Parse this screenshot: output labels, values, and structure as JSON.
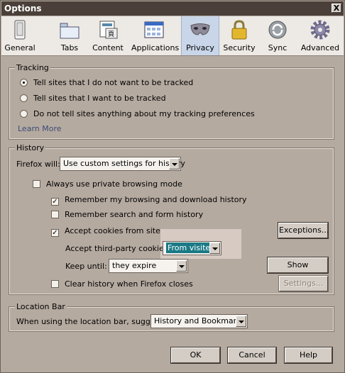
{
  "window": {
    "title": "Options",
    "close_label": "X"
  },
  "toolbar": {
    "items": [
      {
        "label": "General",
        "icon": "general-icon"
      },
      {
        "label": "Tabs",
        "icon": "tabs-icon"
      },
      {
        "label": "Content",
        "icon": "content-icon"
      },
      {
        "label": "Applications",
        "icon": "applications-icon"
      },
      {
        "label": "Privacy",
        "icon": "privacy-mask-icon",
        "active": true
      },
      {
        "label": "Security",
        "icon": "lock-icon"
      },
      {
        "label": "Sync",
        "icon": "sync-icon"
      },
      {
        "label": "Advanced",
        "icon": "gear-icon"
      }
    ]
  },
  "tracking": {
    "legend": "Tracking",
    "options": [
      {
        "label": "Tell sites that I do not want to be tracked",
        "selected": true
      },
      {
        "label": "Tell sites that I want to be tracked",
        "selected": false
      },
      {
        "label": "Do not tell sites anything about my tracking preferences",
        "selected": false
      }
    ],
    "learn_more": "Learn More"
  },
  "history": {
    "legend": "History",
    "firefox_will_label": "Firefox will:",
    "firefox_will_value": "Use custom settings for history",
    "always_private": {
      "label": "Always use private browsing mode",
      "checked": false
    },
    "remember_browsing": {
      "label": "Remember my browsing and download history",
      "checked": true
    },
    "remember_search": {
      "label": "Remember search and form history",
      "checked": false
    },
    "accept_cookies": {
      "label": "Accept cookies from sites",
      "checked": true
    },
    "exceptions_button": "Exceptions...",
    "third_party_label": "Accept third-party cookies:",
    "third_party_value": "From visited",
    "keep_until_label": "Keep until:",
    "keep_until_value": "they expire",
    "show_cookies_button": "Show Cookies...",
    "clear_history": {
      "label": "Clear history when Firefox closes",
      "checked": false
    },
    "settings_button": "Settings..."
  },
  "location_bar": {
    "legend": "Location Bar",
    "suggest_label": "When using the location bar, suggest:",
    "suggest_value": "History and Bookmarks"
  },
  "footer": {
    "ok": "OK",
    "cancel": "Cancel",
    "help": "Help"
  },
  "colors": {
    "dialog_bg": "#b5aaa0",
    "title_bg": "#4a4039",
    "selected_bg": "#1b7a86",
    "link": "#3d4c79"
  }
}
